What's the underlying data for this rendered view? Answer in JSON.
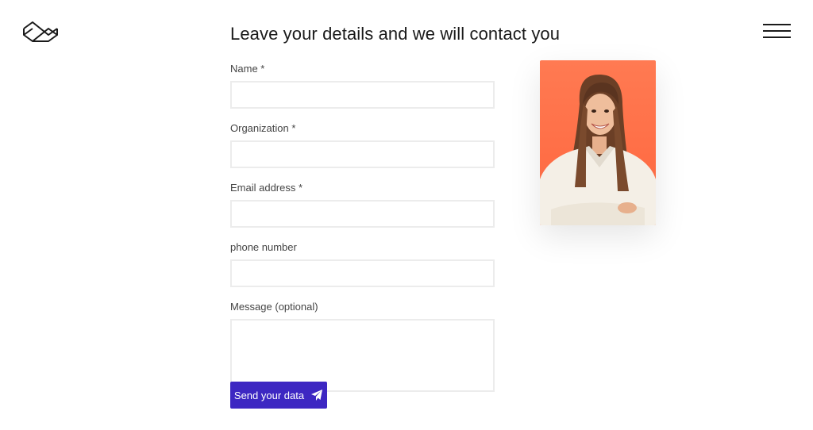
{
  "header": {
    "logo_icon": "brand-logo-icon",
    "menu_icon": "hamburger-menu-icon",
    "title": "Leave your details and we will contact you"
  },
  "form": {
    "name_label": "Name *",
    "organization_label": "Organization *",
    "email_label": "Email address *",
    "phone_label": "phone number",
    "message_label": "Message (optional)",
    "name_value": "",
    "organization_value": "",
    "email_value": "",
    "phone_value": "",
    "message_value": ""
  },
  "submit": {
    "label": "Send your data",
    "icon": "paper-plane-icon",
    "color": "#3d27c2"
  },
  "photo": {
    "background_color": "#ff7a52"
  }
}
